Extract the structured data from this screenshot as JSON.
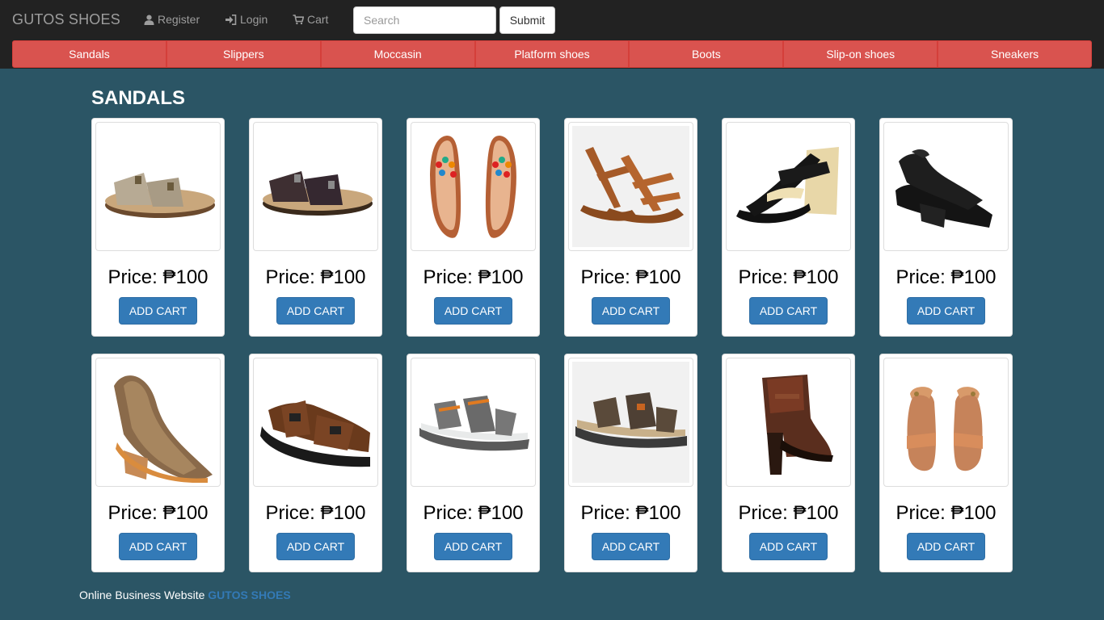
{
  "header": {
    "brand": "GUTOS SHOES",
    "register": "Register",
    "login": "Login",
    "cart": "Cart",
    "search_placeholder": "Search",
    "submit": "Submit"
  },
  "categories": [
    "Sandals",
    "Slippers",
    "Moccasin",
    "Platform shoes",
    "Boots",
    "Slip-on shoes",
    "Sneakers"
  ],
  "section_title": "SANDALS",
  "products": [
    {
      "price": "Price: ₱100",
      "button": "ADD CART",
      "image": "birkenstock-beige-sandal-image"
    },
    {
      "price": "Price: ₱100",
      "button": "ADD CART",
      "image": "birkenstock-brown-sandal-image"
    },
    {
      "price": "Price: ₱100",
      "button": "ADD CART",
      "image": "beaded-thong-sandals-image"
    },
    {
      "price": "Price: ₱100",
      "button": "ADD CART",
      "image": "strappy-gladiator-sandals-image"
    },
    {
      "price": "Price: ₱100",
      "button": "ADD CART",
      "image": "black-wedge-sandal-image"
    },
    {
      "price": "Price: ₱100",
      "button": "ADD CART",
      "image": "black-perforated-wedge-image"
    },
    {
      "price": "Price: ₱100",
      "button": "ADD CART",
      "image": "tan-laser-cut-wedge-image"
    },
    {
      "price": "Price: ₱100",
      "button": "ADD CART",
      "image": "brown-sport-sandal-image"
    },
    {
      "price": "Price: ₱100",
      "button": "ADD CART",
      "image": "grey-orange-sport-sandal-image"
    },
    {
      "price": "Price: ₱100",
      "button": "ADD CART",
      "image": "grey-sport-sandal-image"
    },
    {
      "price": "Price: ₱100",
      "button": "ADD CART",
      "image": "brown-heeled-bootie-image"
    },
    {
      "price": "Price: ₱100",
      "button": "ADD CART",
      "image": "tan-ankle-strap-sandals-image"
    }
  ],
  "footer": {
    "text": "Online Business Website",
    "brand": "GUTOS SHOES"
  },
  "colors": {
    "page_bg": "#2b5565",
    "navbar_bg": "#222222",
    "category_bg": "#d9534f",
    "button_bg": "#337ab7"
  }
}
